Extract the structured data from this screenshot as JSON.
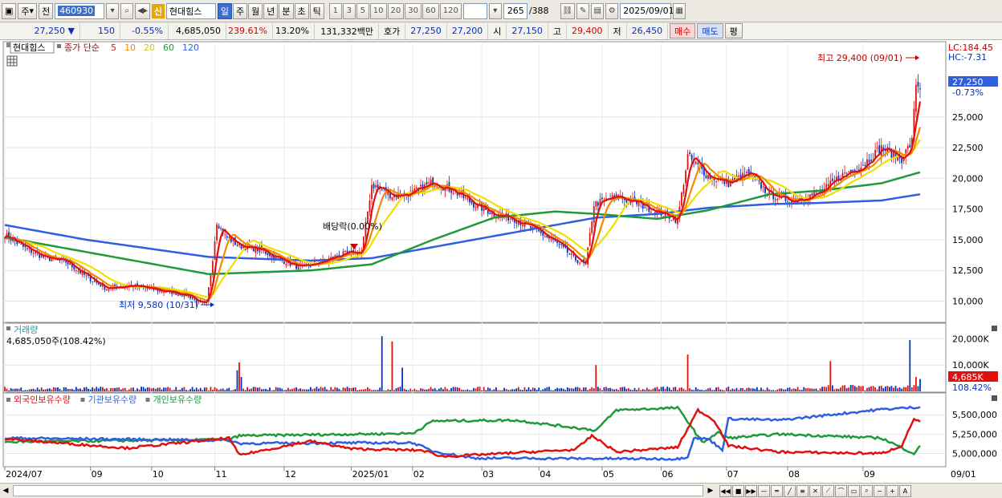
{
  "toolbar": {
    "type_label": "주",
    "prefix_label": "전",
    "code": "460930",
    "sin_badge": "신",
    "stock_name": "현대힘스",
    "periods": [
      "일",
      "주",
      "월",
      "년",
      "분",
      "초",
      "틱"
    ],
    "active_period": "일",
    "minutes": [
      "1",
      "3",
      "5",
      "10",
      "20",
      "30",
      "60",
      "120"
    ],
    "count_value": "265",
    "count_total": "/388",
    "date": "2025/09/01"
  },
  "quote": {
    "price": "27,250",
    "change": "150",
    "change_pct": "-0.55%",
    "volume": "4,685,050",
    "vol_ratio": "239.61%",
    "turnover_rate": "13.20%",
    "amount": "131,332백만",
    "ask_label": "호가",
    "ask": "27,250",
    "bid": "27,200",
    "open_label": "시",
    "open": "27,150",
    "high_label": "고",
    "high": "29,400",
    "low_label": "저",
    "low": "26,450",
    "buy_button": "매수",
    "sell_button": "매도",
    "eval_button": "평"
  },
  "price_panel": {
    "stock_label": "현대힘스",
    "ma_prefix": "종가 단순",
    "ma_periods": [
      {
        "label": "5",
        "color": "#e01010"
      },
      {
        "label": "10",
        "color": "#f08c00"
      },
      {
        "label": "20",
        "color": "#f0e000"
      },
      {
        "label": "60",
        "color": "#1e9a3c"
      },
      {
        "label": "120",
        "color": "#2f5fe0"
      }
    ],
    "lc_label": "LC:184.45",
    "hc_label": "HC:-7.31",
    "current_price_tag": "27,250",
    "current_pct_tag": "-0.73%",
    "high_annotation": "최고 29,400 (09/01)",
    "low_annotation": "최저 9,580 (10/31)",
    "dividend_annotation": "배당락(0.00%)"
  },
  "volume_panel": {
    "title": "거래량",
    "info": "4,685,050주(108.42%)",
    "current_tag": "4,685K",
    "current_pct": "108.42%"
  },
  "holding_panel": {
    "legend": [
      {
        "label": "외국인보유수량",
        "color": "#e01010"
      },
      {
        "label": "기관보유수량",
        "color": "#2f5fe0"
      },
      {
        "label": "개인보유수량",
        "color": "#1e9a3c"
      }
    ]
  },
  "colors": {
    "up": "#e01010",
    "down": "#0030c0",
    "accent": "#3a6fd0"
  },
  "chart_data": {
    "type": "candlestick",
    "x_tick_labels": [
      "2024/07",
      "09",
      "10",
      "11",
      "12",
      "2025/01",
      "02",
      "03",
      "04",
      "05",
      "06",
      "07",
      "08",
      "09",
      "09/01"
    ],
    "price_axis": [
      "25,000",
      "22,500",
      "20,000",
      "17,500",
      "15,000",
      "12,500",
      "10,000"
    ],
    "price_ylim": [
      8400,
      31000
    ],
    "volume_axis": [
      "20,000K",
      "10,000K"
    ],
    "volume_ylim": [
      0,
      25000
    ],
    "holding_axis": [
      "5,500,000",
      "5,250,000",
      "5,000,000"
    ],
    "holding_ylim": [
      4850000,
      5720000
    ],
    "price_anchors": [
      [
        0,
        15400
      ],
      [
        10,
        14300
      ],
      [
        20,
        13500
      ],
      [
        30,
        13200
      ],
      [
        40,
        12000
      ],
      [
        50,
        11000
      ],
      [
        60,
        11300
      ],
      [
        75,
        10900
      ],
      [
        90,
        10500
      ],
      [
        95,
        9800
      ],
      [
        99,
        9800
      ],
      [
        102,
        13500
      ],
      [
        104,
        16500
      ],
      [
        108,
        15300
      ],
      [
        115,
        14500
      ],
      [
        125,
        14200
      ],
      [
        135,
        13400
      ],
      [
        145,
        12700
      ],
      [
        155,
        13200
      ],
      [
        165,
        13800
      ],
      [
        175,
        14000
      ],
      [
        180,
        19500
      ],
      [
        190,
        18600
      ],
      [
        200,
        18800
      ],
      [
        210,
        19700
      ],
      [
        220,
        19000
      ],
      [
        230,
        17900
      ],
      [
        240,
        17100
      ],
      [
        250,
        16700
      ],
      [
        260,
        15800
      ],
      [
        270,
        14800
      ],
      [
        280,
        13400
      ],
      [
        285,
        12900
      ],
      [
        289,
        17900
      ],
      [
        300,
        18500
      ],
      [
        310,
        18000
      ],
      [
        320,
        17300
      ],
      [
        330,
        16600
      ],
      [
        335,
        21800
      ],
      [
        345,
        20200
      ],
      [
        355,
        19600
      ],
      [
        365,
        20400
      ],
      [
        375,
        18700
      ],
      [
        385,
        18200
      ],
      [
        400,
        18800
      ],
      [
        410,
        20200
      ],
      [
        420,
        21000
      ],
      [
        430,
        22500
      ],
      [
        440,
        21600
      ],
      [
        445,
        23000
      ],
      [
        447,
        27800
      ],
      [
        449,
        27250
      ]
    ],
    "ma60_anchors": [
      [
        0,
        15200
      ],
      [
        40,
        14000
      ],
      [
        100,
        12200
      ],
      [
        150,
        12500
      ],
      [
        180,
        13000
      ],
      [
        210,
        15000
      ],
      [
        240,
        16800
      ],
      [
        270,
        17300
      ],
      [
        290,
        17100
      ],
      [
        320,
        16700
      ],
      [
        345,
        17400
      ],
      [
        375,
        18700
      ],
      [
        400,
        19000
      ],
      [
        430,
        19600
      ],
      [
        449,
        20500
      ]
    ],
    "ma120_anchors": [
      [
        0,
        16200
      ],
      [
        40,
        15000
      ],
      [
        100,
        13600
      ],
      [
        150,
        13300
      ],
      [
        180,
        13500
      ],
      [
        240,
        15300
      ],
      [
        290,
        16800
      ],
      [
        320,
        17100
      ],
      [
        345,
        17600
      ],
      [
        375,
        17900
      ],
      [
        400,
        18000
      ],
      [
        430,
        18200
      ],
      [
        449,
        18700
      ]
    ],
    "volume_spikes": [
      [
        114,
        8000
      ],
      [
        115,
        11000
      ],
      [
        116,
        5500
      ],
      [
        185,
        21000
      ],
      [
        190,
        19000
      ],
      [
        195,
        9000
      ],
      [
        290,
        10000
      ],
      [
        335,
        14000
      ],
      [
        405,
        11500
      ],
      [
        444,
        19500
      ],
      [
        447,
        5500
      ],
      [
        449,
        4685
      ]
    ],
    "foreign_anchors": [
      [
        0,
        5190
      ],
      [
        60,
        5070
      ],
      [
        110,
        5200
      ],
      [
        115,
        4980
      ],
      [
        150,
        5160
      ],
      [
        170,
        5060
      ],
      [
        205,
        5040
      ],
      [
        215,
        4960
      ],
      [
        280,
        5050
      ],
      [
        288,
        5230
      ],
      [
        300,
        5020
      ],
      [
        330,
        5080
      ],
      [
        340,
        5560
      ],
      [
        348,
        5430
      ],
      [
        355,
        5100
      ],
      [
        380,
        5020
      ],
      [
        430,
        5000
      ],
      [
        440,
        5100
      ],
      [
        446,
        5450
      ],
      [
        449,
        5410
      ]
    ],
    "inst_anchors": [
      [
        0,
        5200
      ],
      [
        110,
        5170
      ],
      [
        115,
        5130
      ],
      [
        200,
        5140
      ],
      [
        210,
        5030
      ],
      [
        230,
        4940
      ],
      [
        330,
        4930
      ],
      [
        335,
        4960
      ],
      [
        338,
        5200
      ],
      [
        345,
        5190
      ],
      [
        352,
        5050
      ],
      [
        355,
        5450
      ],
      [
        380,
        5430
      ],
      [
        430,
        5570
      ],
      [
        449,
        5600
      ]
    ],
    "indiv_anchors": [
      [
        0,
        5150
      ],
      [
        110,
        5180
      ],
      [
        115,
        5230
      ],
      [
        200,
        5260
      ],
      [
        210,
        5420
      ],
      [
        250,
        5430
      ],
      [
        290,
        5300
      ],
      [
        300,
        5560
      ],
      [
        330,
        5590
      ],
      [
        336,
        5380
      ],
      [
        342,
        5140
      ],
      [
        350,
        5270
      ],
      [
        355,
        5200
      ],
      [
        380,
        5250
      ],
      [
        430,
        5200
      ],
      [
        446,
        5000
      ],
      [
        449,
        5090
      ]
    ],
    "n_days": 450
  }
}
